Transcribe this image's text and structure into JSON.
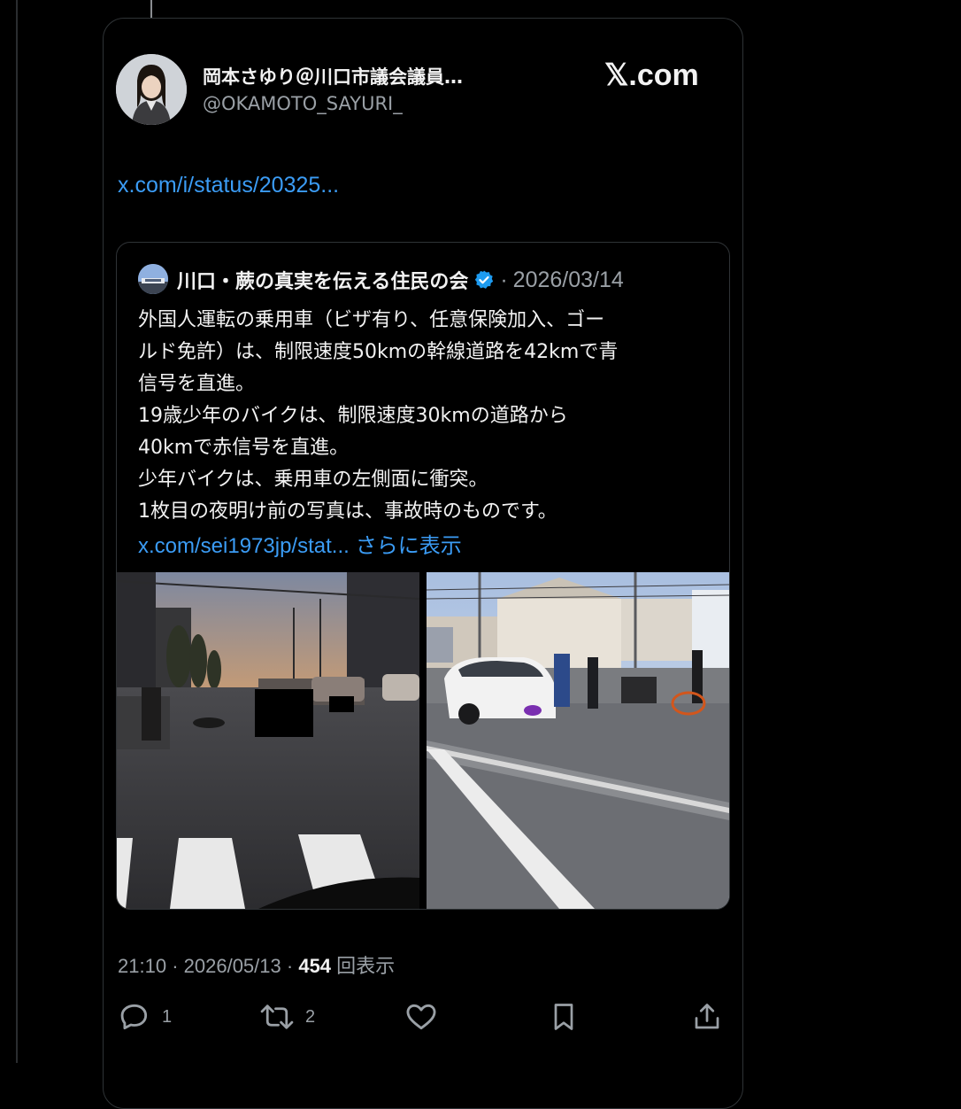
{
  "author": {
    "display_name": "岡本さゆり＠川口市議会議員…",
    "handle": "@OKAMOTO_SAYURI_"
  },
  "site_label": "𝕏.com",
  "status_link": "x.com/i/status/20325...",
  "quoted": {
    "name": "川口・蕨の真実を伝える住民の会",
    "separator": "·",
    "date": "2026/03/14",
    "lines": [
      "外国人運転の乗用車（ビザ有り、任意保険加入、ゴー",
      "ルド免許）は、制限速度50kmの幹線道路を42kmで青",
      "信号を直進。",
      "19歳少年のバイクは、制限速度30kmの道路から",
      "40kmで赤信号を直進。",
      "少年バイクは、乗用車の左側面に衝突。",
      "1枚目の夜明け前の写真は、事故時のものです。"
    ],
    "link": "x.com/sei1973jp/stat...",
    "show_more": "さらに表示"
  },
  "meta": {
    "time": "21:10",
    "dot1": "·",
    "date": "2026/05/13",
    "dot2": "·",
    "views_count": "454",
    "views_label": "回表示"
  },
  "actions": {
    "reply_count": "1",
    "repost_count": "2"
  },
  "colors": {
    "link": "#3b9cf5",
    "muted": "#9aa0a6",
    "border": "#2f3336",
    "verified": "#1d9bf0"
  }
}
